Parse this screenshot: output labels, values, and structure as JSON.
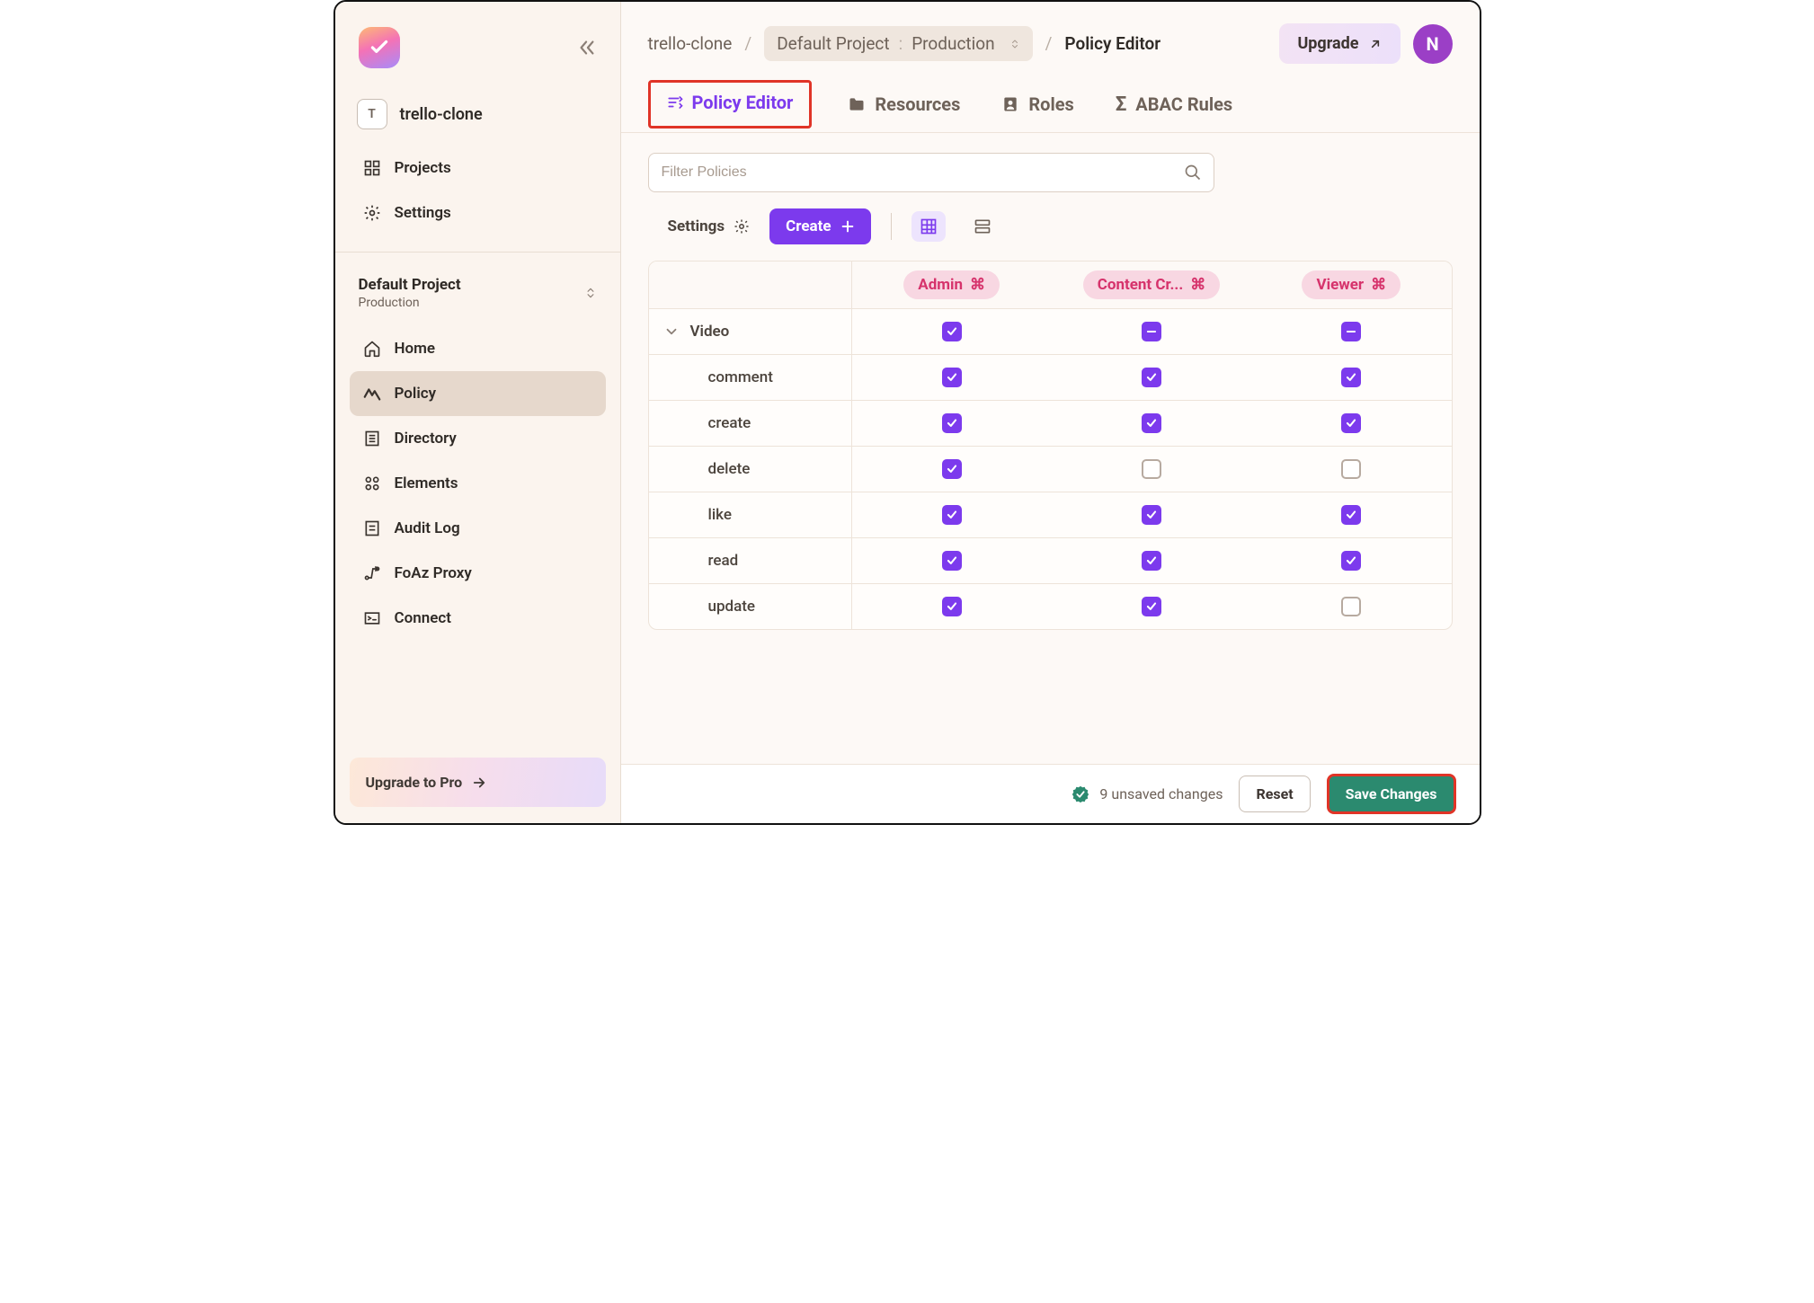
{
  "workspace": {
    "chip": "T",
    "name": "trello-clone"
  },
  "sidebar": {
    "top": [
      {
        "id": "projects",
        "label": "Projects"
      },
      {
        "id": "settings",
        "label": "Settings"
      }
    ],
    "project": {
      "name": "Default Project",
      "env": "Production"
    },
    "items": [
      {
        "id": "home",
        "label": "Home"
      },
      {
        "id": "policy",
        "label": "Policy"
      },
      {
        "id": "directory",
        "label": "Directory"
      },
      {
        "id": "elements",
        "label": "Elements"
      },
      {
        "id": "auditlog",
        "label": "Audit Log"
      },
      {
        "id": "foaz",
        "label": "FoAz Proxy"
      },
      {
        "id": "connect",
        "label": "Connect"
      }
    ],
    "upgrade": "Upgrade to Pro"
  },
  "breadcrumb": {
    "workspace": "trello-clone",
    "project": "Default Project",
    "env": "Production",
    "page": "Policy Editor"
  },
  "header": {
    "upgrade": "Upgrade",
    "avatar": "N"
  },
  "tabs": [
    {
      "id": "editor",
      "label": "Policy Editor"
    },
    {
      "id": "resources",
      "label": "Resources"
    },
    {
      "id": "roles",
      "label": "Roles"
    },
    {
      "id": "abac",
      "label": "ABAC Rules"
    }
  ],
  "filter": {
    "placeholder": "Filter Policies"
  },
  "toolbar": {
    "settings": "Settings",
    "create": "Create"
  },
  "roles": [
    {
      "id": "admin",
      "label": "Admin"
    },
    {
      "id": "content",
      "label": "Content Cr..."
    },
    {
      "id": "viewer",
      "label": "Viewer"
    }
  ],
  "resource": {
    "name": "Video",
    "summary": {
      "admin": "checked",
      "content": "indeterminate",
      "viewer": "indeterminate"
    },
    "actions": [
      {
        "name": "comment",
        "admin": "checked",
        "content": "checked",
        "viewer": "checked"
      },
      {
        "name": "create",
        "admin": "checked",
        "content": "checked",
        "viewer": "checked"
      },
      {
        "name": "delete",
        "admin": "checked",
        "content": "unchecked",
        "viewer": "unchecked"
      },
      {
        "name": "like",
        "admin": "checked",
        "content": "checked",
        "viewer": "checked"
      },
      {
        "name": "read",
        "admin": "checked",
        "content": "checked",
        "viewer": "checked"
      },
      {
        "name": "update",
        "admin": "checked",
        "content": "checked",
        "viewer": "unchecked"
      }
    ]
  },
  "footer": {
    "status": "9 unsaved changes",
    "reset": "Reset",
    "save": "Save Changes"
  }
}
